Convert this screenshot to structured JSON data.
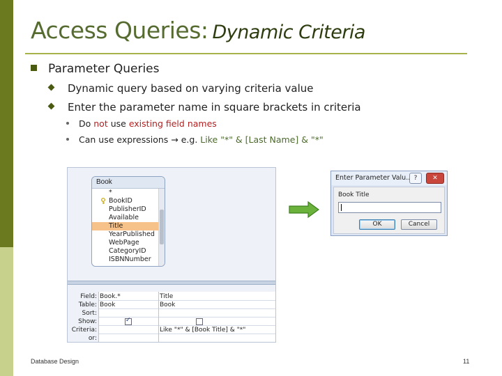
{
  "slide": {
    "title_main": "Access Queries:",
    "title_italic": "Dynamic Criteria",
    "level1": "Parameter Queries",
    "level2": [
      "Dynamic query based on varying criteria value",
      "Enter the parameter name in square brackets in criteria"
    ],
    "level3_a": {
      "prefix": "Do ",
      "not": "not",
      "mid": " use ",
      "highlight": "existing field names"
    },
    "level3_b": {
      "prefix": "Can use expressions → e.g. ",
      "expr": "Like \"*\" & [Last Name] & \"*\""
    },
    "footer_left": "Database Design",
    "page_number": "11"
  },
  "design_view": {
    "table_name": "Book",
    "fields": [
      "*",
      "BookID",
      "PublisherID",
      "Available",
      "Title",
      "YearPublished",
      "WebPage",
      "CategoryID",
      "ISBNNumber"
    ],
    "selected_field": "Title",
    "grid_labels": [
      "Field:",
      "Table:",
      "Sort:",
      "Show:",
      "Criteria:",
      "or:"
    ],
    "col1": {
      "field": "Book.*",
      "table": "Book",
      "show": true,
      "criteria": ""
    },
    "col2": {
      "field": "Title",
      "table": "Book",
      "show": false,
      "criteria": "Like \"*\" & [Book Title] & \"*\""
    }
  },
  "dialog": {
    "title": "Enter Parameter Valu...",
    "help": "?",
    "close": "✕",
    "prompt": "Book Title",
    "input_value": "",
    "ok_label": "OK",
    "cancel_label": "Cancel"
  },
  "colors": {
    "sidebar_dark": "#6b7a1e",
    "sidebar_light": "#c7d18b",
    "accent_red": "#b22222",
    "accent_green": "#4b6b2a",
    "arrow": "#6ab23c"
  },
  "icons": {
    "bullet1": "square-bullet",
    "bullet2": "diamond-bullet",
    "bullet3": "dot-bullet",
    "arrow": "right-arrow-icon",
    "key": "primary-key-icon"
  }
}
